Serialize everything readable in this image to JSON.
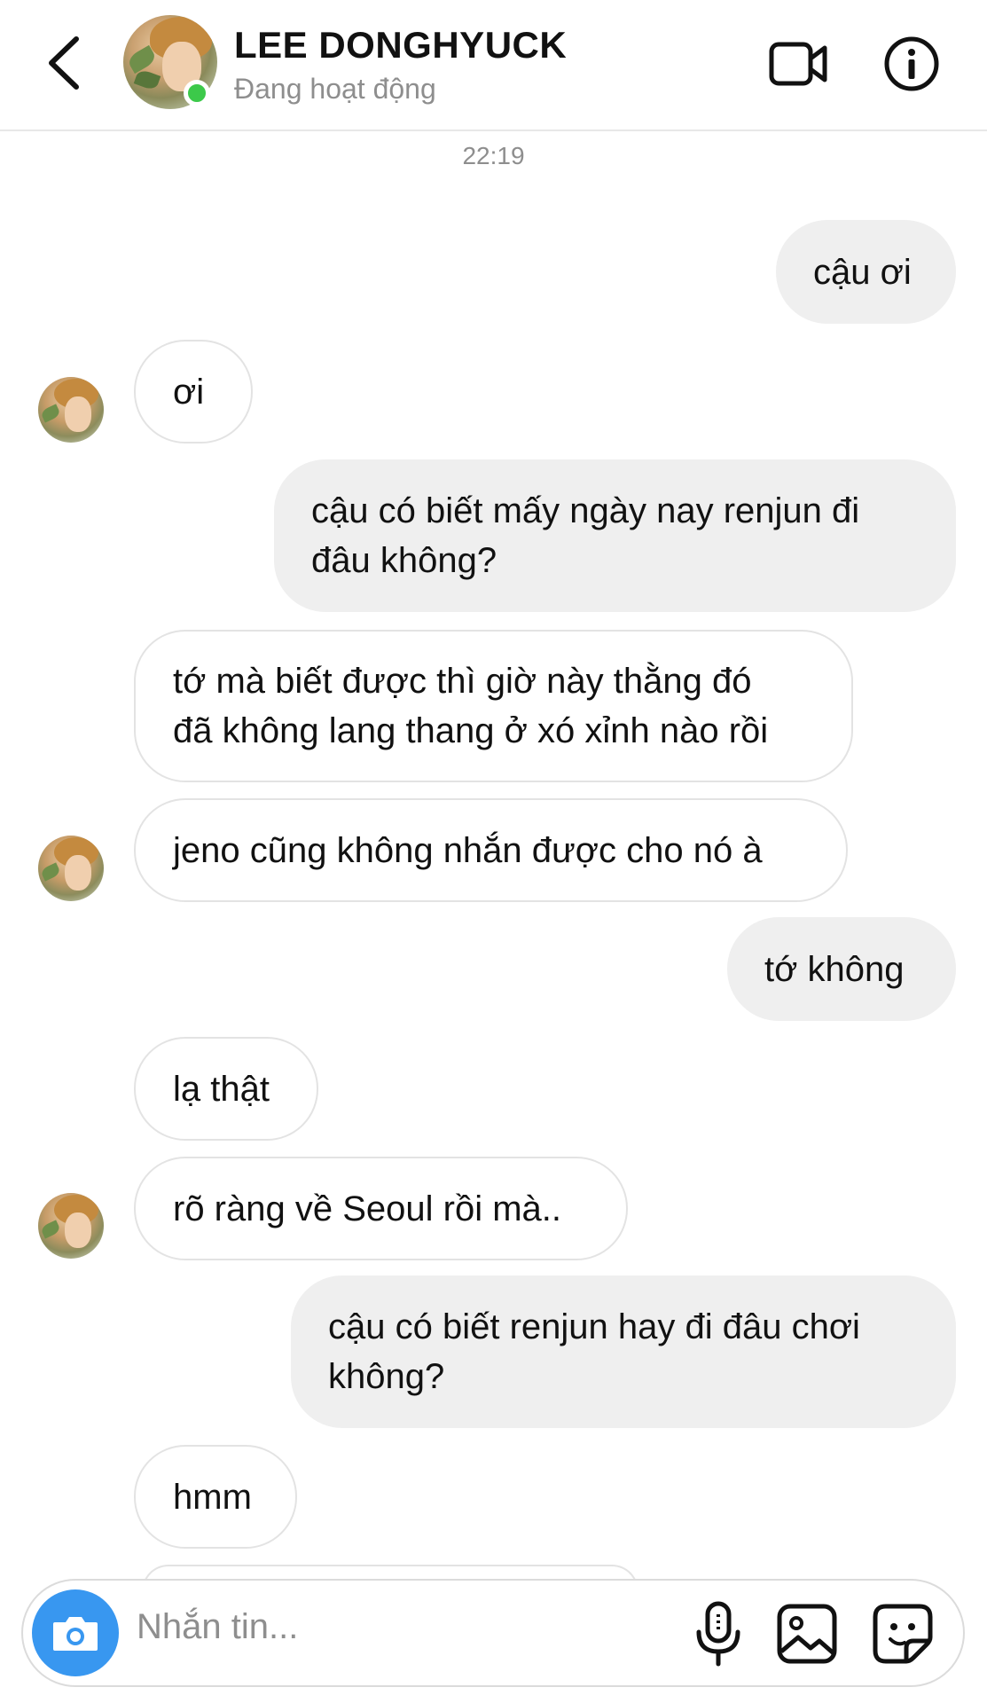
{
  "header": {
    "contact_name": "LEE DONGHYUCK",
    "status": "Đang hoạt động"
  },
  "thread": {
    "timestamp": "22:19",
    "messages": [
      {
        "from": "me",
        "lines": [
          "cậu ơi"
        ]
      },
      {
        "from": "them",
        "lines": [
          "ơi"
        ]
      },
      {
        "from": "me",
        "lines": [
          "cậu có biết mấy ngày nay renjun đi",
          "đâu không?"
        ]
      },
      {
        "from": "them",
        "lines": [
          "tớ mà biết được thì giờ này thằng đó",
          "đã không lang thang ở xó xỉnh nào rồi"
        ]
      },
      {
        "from": "them",
        "lines": [
          "jeno cũng không nhắn được cho nó à"
        ]
      },
      {
        "from": "me",
        "lines": [
          "tớ không"
        ]
      },
      {
        "from": "them",
        "lines": [
          "lạ thật"
        ]
      },
      {
        "from": "them",
        "lines": [
          "rõ ràng về Seoul rồi mà.."
        ]
      },
      {
        "from": "me",
        "lines": [
          "cậu có biết renjun hay đi đâu chơi",
          "không?"
        ]
      },
      {
        "from": "them",
        "lines": [
          "hmm"
        ]
      }
    ]
  },
  "composer": {
    "placeholder": "Nhắn tin..."
  },
  "colors": {
    "accent": "#3897f0",
    "online": "#3cc94a",
    "outgoing_bubble": "#efefef"
  },
  "icons": [
    "back-arrow-icon",
    "video-camera-icon",
    "info-icon",
    "camera-icon",
    "microphone-icon",
    "gallery-icon",
    "sticker-icon"
  ]
}
